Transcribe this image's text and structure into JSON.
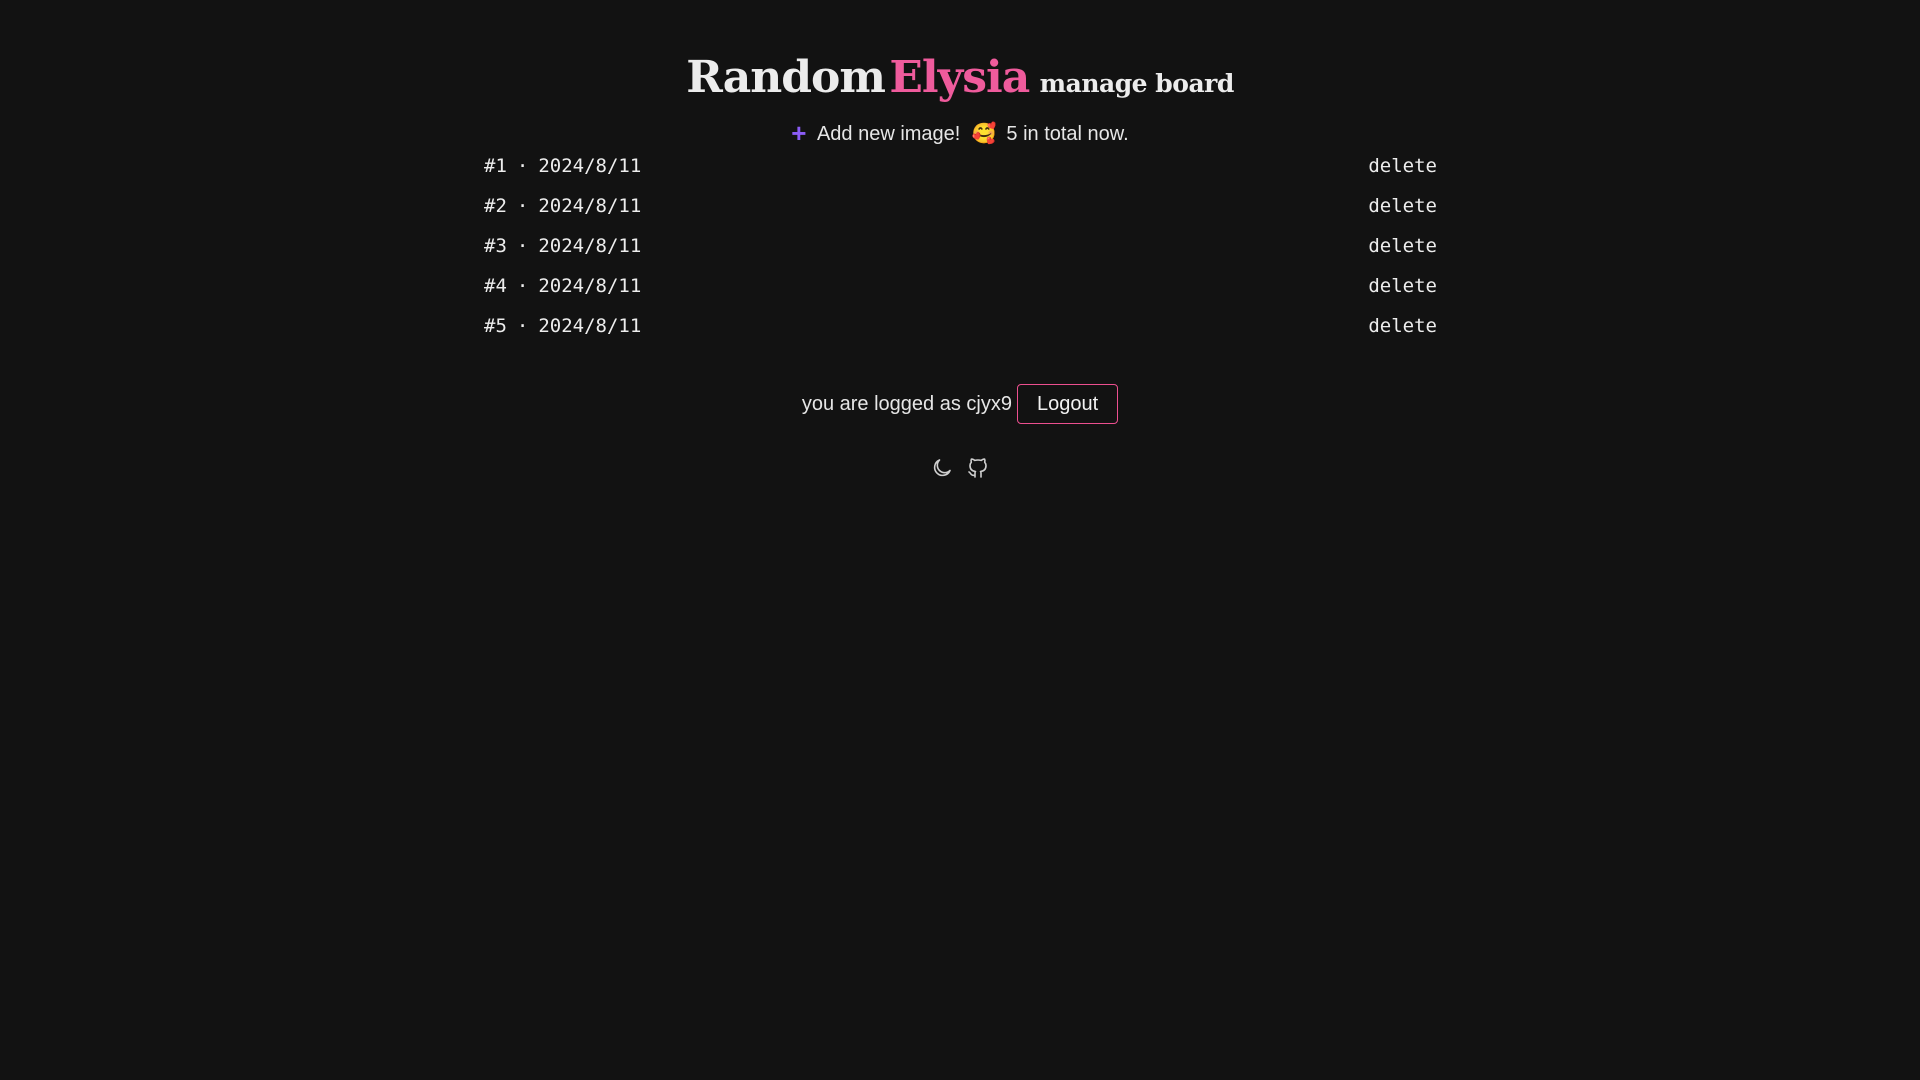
{
  "header": {
    "title_main": "Random",
    "title_accent": "Elysia",
    "title_sub": "manage board"
  },
  "add_bar": {
    "add_label": "Add new image!",
    "emoji": "🥰",
    "total_text": "5 in total now."
  },
  "images": [
    {
      "id": "#1",
      "separator": "·",
      "date": "2024/8/11",
      "action": "delete"
    },
    {
      "id": "#2",
      "separator": "·",
      "date": "2024/8/11",
      "action": "delete"
    },
    {
      "id": "#3",
      "separator": "·",
      "date": "2024/8/11",
      "action": "delete"
    },
    {
      "id": "#4",
      "separator": "·",
      "date": "2024/8/11",
      "action": "delete"
    },
    {
      "id": "#5",
      "separator": "·",
      "date": "2024/8/11",
      "action": "delete"
    }
  ],
  "login": {
    "status_text": "you are logged as cjyx9",
    "logout_label": "Logout"
  },
  "footer_icons": [
    "moon-icon",
    "github-icon"
  ],
  "colors": {
    "background": "#121212",
    "accent_pink": "#ef5b9c",
    "plus_purple": "#8b5cf6",
    "logout_border": "#ec4f8f"
  }
}
